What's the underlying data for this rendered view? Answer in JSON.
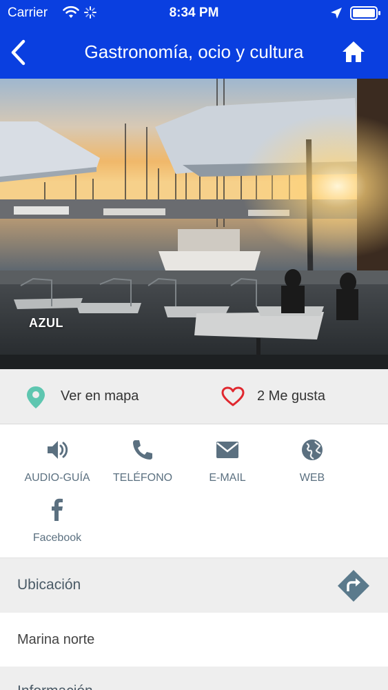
{
  "status_bar": {
    "carrier": "Carrier",
    "time": "8:34 PM"
  },
  "nav": {
    "title": "Gastronomía, ocio y cultura"
  },
  "hero": {
    "caption": "AZUL"
  },
  "actions": {
    "map_label": "Ver en mapa",
    "like_label": "2 Me gusta"
  },
  "contacts": [
    {
      "label": "AUDIO-GUÍA",
      "icon": "speaker-icon"
    },
    {
      "label": "TELÉFONO",
      "icon": "phone-icon"
    },
    {
      "label": "E-MAIL",
      "icon": "mail-icon"
    },
    {
      "label": "WEB",
      "icon": "globe-icon"
    },
    {
      "label": "Facebook",
      "icon": "facebook-icon"
    }
  ],
  "location": {
    "heading": "Ubicación",
    "value": "Marina norte"
  },
  "next_section": {
    "heading": "Información"
  },
  "colors": {
    "nav_bg": "#0a3fe0",
    "icon_grey": "#5b7080",
    "pin_teal": "#5ec6b0",
    "heart_red": "#e0282f"
  }
}
